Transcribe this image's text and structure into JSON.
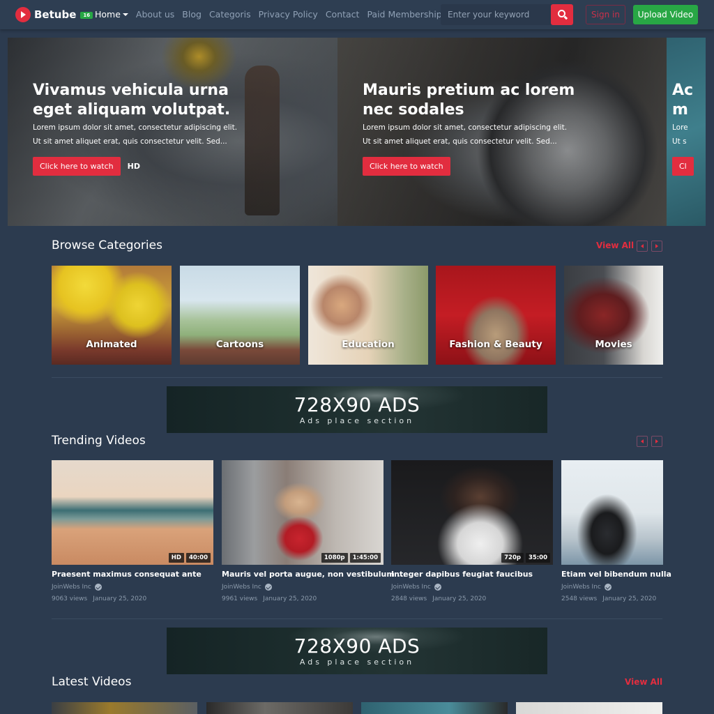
{
  "navbar": {
    "brand": "Betube",
    "brand_badge": "16",
    "links": [
      {
        "label": "Home",
        "active": true,
        "dropdown": true
      },
      {
        "label": "About us"
      },
      {
        "label": "Blog"
      },
      {
        "label": "Categoris"
      },
      {
        "label": "Privacy Policy"
      },
      {
        "label": "Contact"
      },
      {
        "label": "Paid Membership",
        "dropdown": true
      }
    ],
    "search": {
      "placeholder": "Enter your keyword",
      "value": "",
      "icon": "search-icon"
    },
    "signin_label": "Sign in",
    "upload_label": "Upload Video"
  },
  "hero": {
    "slides": [
      {
        "title": "Vivamus vehicula urna eget aliquam volutpat.",
        "text_line1": "Lorem ipsum dolor sit amet, consectetur adipiscing elit.",
        "text_line2": "Ut sit amet aliquet erat, quis consectetur velit. Sed...",
        "button": "Click here to watch",
        "quality": "HD"
      },
      {
        "title": "Mauris pretium ac lorem nec sodales",
        "text_line1": "Lorem ipsum dolor sit amet, consectetur adipiscing elit.",
        "text_line2": "Ut sit amet aliquet erat, quis consectetur velit. Sed...",
        "button": "Click here to watch"
      },
      {
        "title": "Ac m",
        "text_line1": "Lore",
        "text_line2": "Ut s",
        "button": "Cl"
      }
    ]
  },
  "categories": {
    "title": "Browse Categories",
    "view_all": "View All",
    "items": [
      {
        "label": "Animated"
      },
      {
        "label": "Cartoons"
      },
      {
        "label": "Education"
      },
      {
        "label": "Fashion & Beauty"
      },
      {
        "label": "Movies"
      }
    ]
  },
  "ads": {
    "title": "728X90 ADS",
    "subtitle": "Ads place section"
  },
  "trending": {
    "title": "Trending Videos",
    "videos": [
      {
        "title": "Praesent maximus consequat ante",
        "quality": "HD",
        "duration": "40:00",
        "channel": "JoinWebs Inc",
        "views": "9063 views",
        "date": "January 25, 2020"
      },
      {
        "title": "Mauris vel porta augue, non vestibulum ...",
        "quality": "1080p",
        "duration": "1:45:00",
        "channel": "JoinWebs Inc",
        "views": "9961 views",
        "date": "January 25, 2020"
      },
      {
        "title": "Integer dapibus feugiat faucibus",
        "quality": "720p",
        "duration": "35:00",
        "channel": "JoinWebs Inc",
        "views": "2848 views",
        "date": "January 25, 2020"
      },
      {
        "title": "Etiam vel bibendum nulla",
        "channel": "JoinWebs Inc",
        "views": "2548 views",
        "date": "January 25, 2020"
      }
    ]
  },
  "latest": {
    "title": "Latest Videos",
    "view_all": "View All"
  },
  "colors": {
    "accent": "#e22d3f",
    "success": "#28a745",
    "background": "#2c3b4f"
  }
}
